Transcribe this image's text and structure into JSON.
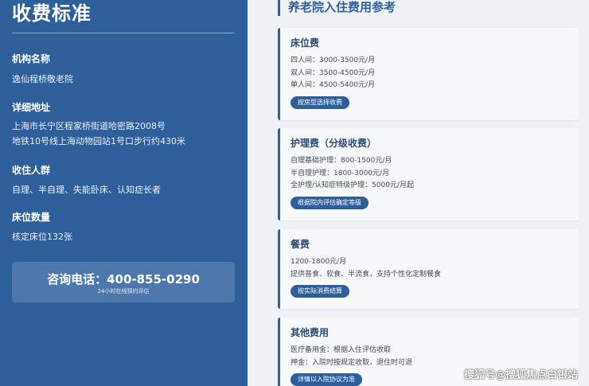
{
  "left": {
    "title": "收费标准",
    "institution": {
      "label": "机构名称",
      "value": "逸仙程桥敬老院"
    },
    "address": {
      "label": "详细地址",
      "lines": [
        "上海市长宁区程家桥街道哈密路2008号",
        "地铁10号线上海动物园站1号口步行约430米"
      ]
    },
    "residents": {
      "label": "收住人群",
      "value": "自理、半自理、失能卧床、认知症长者"
    },
    "beds": {
      "label": "床位数量",
      "value": "核定床位132张"
    },
    "hotline": {
      "main": "咨询电话：400-855-0290",
      "sub": "24小时在线预约评估"
    }
  },
  "right": {
    "title": "养老院入住费用参考",
    "cards": [
      {
        "title": "床位费",
        "lines": [
          "四人间：3000-3500元/月",
          "双人间：3500-4500元/月",
          "单人间：4500-5400元/月"
        ],
        "badge": "按房型选择收费"
      },
      {
        "title": "护理费（分级收费）",
        "lines": [
          "自理基础护理：800-1500元/月",
          "半自理护理：1800-3000元/月",
          "全护理/认知症特级护理：5000元/月起"
        ],
        "badge": "根据院内评估确定等级"
      },
      {
        "title": "餐费",
        "lines": [
          "1200-1800元/月",
          "提供普食、软食、半流食，支持个性化定制餐食"
        ],
        "badge": "按实际消费结算"
      },
      {
        "title": "其他费用",
        "lines": [
          "医疗备用金：根据入住评估收取",
          "押金：入院时按规定收取，退住时可退"
        ],
        "badge": "详情以入院协议为准"
      }
    ]
  },
  "watermark": "搜狐号@搜狐焦点白银站"
}
